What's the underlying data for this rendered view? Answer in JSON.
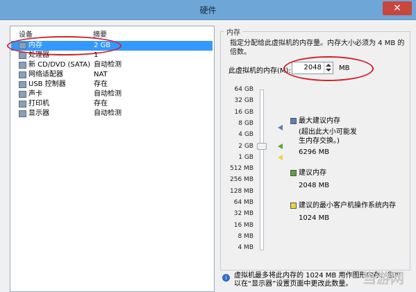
{
  "window": {
    "title": "硬件"
  },
  "device_list": {
    "columns": {
      "device": "设备",
      "summary": "摘要"
    },
    "rows": [
      {
        "name": "内存",
        "summary": "2 GB",
        "icon": "memory-icon",
        "selected": true
      },
      {
        "name": "处理器",
        "summary": "1",
        "icon": "cpu-icon"
      },
      {
        "name": "新 CD/DVD (SATA)",
        "summary": "自动检测",
        "icon": "cd-icon"
      },
      {
        "name": "网络适配器",
        "summary": "NAT",
        "icon": "network-icon"
      },
      {
        "name": "USB 控制器",
        "summary": "存在",
        "icon": "usb-icon"
      },
      {
        "name": "声卡",
        "summary": "自动检测",
        "icon": "sound-icon"
      },
      {
        "name": "打印机",
        "summary": "存在",
        "icon": "printer-icon"
      },
      {
        "name": "显示器",
        "summary": "自动检测",
        "icon": "display-icon"
      }
    ]
  },
  "memory": {
    "group_title": "内存",
    "description": "指定分配给此虚拟机的内存量。内存大小必须为 4 MB 的倍数。",
    "label": "此虚拟机的内存(M):",
    "value": "2048",
    "unit": "MB",
    "ticks": [
      "64 GB",
      "32 GB",
      "16 GB",
      "8 GB",
      "4 GB",
      "2 GB",
      "1 GB",
      "512 MB",
      "256 MB",
      "128 MB",
      "64 MB",
      "32 MB",
      "16 MB",
      "8 MB",
      "4 MB"
    ],
    "slider_value": "2 GB",
    "legend": {
      "max_label": "最大建议内存",
      "max_note": "(超出此大小可能发生内存交换。)",
      "max_value": "6296 MB",
      "rec_label": "建议内存",
      "rec_value": "2048 MB",
      "min_label": "建议的最小客户机操作系统内存",
      "min_value": "1024 MB"
    },
    "info": "虚拟机最多将此内存的 1024 MB 用作图形内存。您可以在“显示器”设置页面中更改此数量。"
  },
  "colors": {
    "max": "#5b7fb8",
    "rec": "#5aa33a",
    "min": "#e7d83a",
    "highlight": "#d0202a"
  },
  "watermark": "当游网"
}
